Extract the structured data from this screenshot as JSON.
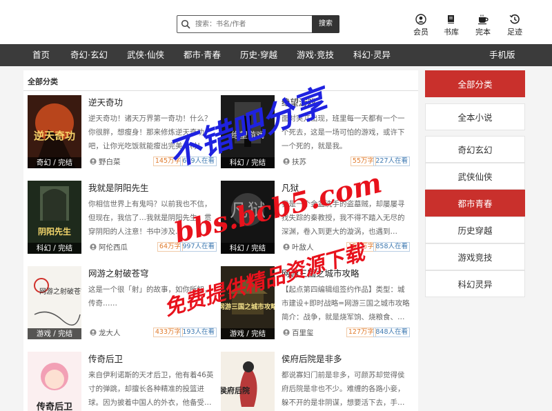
{
  "header": {
    "search_placeholder": "搜索：书名/作者",
    "search_button": "搜索",
    "tools": [
      {
        "label": "会员",
        "icon": "user-icon"
      },
      {
        "label": "书库",
        "icon": "book-icon"
      },
      {
        "label": "完本",
        "icon": "cup-icon"
      },
      {
        "label": "足迹",
        "icon": "history-icon"
      }
    ]
  },
  "nav": {
    "items": [
      "首页",
      "奇幻·玄幻",
      "武侠·仙侠",
      "都市·青春",
      "历史·穿越",
      "游戏·竞技",
      "科幻·灵异"
    ],
    "mobile": "手机版"
  },
  "main": {
    "title": "全部分类",
    "books": [
      {
        "title": "逆天奇功",
        "desc": "逆天奇功！诸天万界第一奇功！什么？你很胖，想瘦身！那来修炼逆天奇功吧，让你光吃饭就能瘦出完美身材！",
        "author": "野白菜",
        "words": "145万字",
        "reads": "659人在看",
        "tag": "奇幻 / 完结",
        "cover_text": "逆天奇功"
      },
      {
        "title": "绝望游戏",
        "desc": "面对突兀出现，班里每一天都有一个一个死去，这是一场可怕的游戏，或许下一个死的，就是我。",
        "author": "扶苏",
        "words": "55万字",
        "reads": "227人在看",
        "tag": "科幻 / 完结",
        "cover_text": "绝望游戏"
      },
      {
        "title": "我就是阴阳先生",
        "desc": "你相信世界上有鬼吗？以前我也不信，但现在，我信了…我就是阴阳先生，贯穿阴阳的人注意！书中涉及…",
        "author": "阿伦西瓜",
        "words": "64万字",
        "reads": "997人在看",
        "tag": "科幻 / 完结",
        "cover_text": "阴阳先生"
      },
      {
        "title": "凡狱",
        "desc": "我是一个金盆洗手的盗墓贼，却屡屡寻找失踪的秦教授，我不得不踏入无尽的深渊，卷入到更大的漩涡，也遇到…",
        "author": "叶敌人",
        "words": "157万字",
        "reads": "858人在看",
        "tag": "科幻 / 完结",
        "cover_text": "凡狱"
      },
      {
        "title": "网游之射破苍穹",
        "desc": "这是一个很「射」的故事，如你所知，传奇……",
        "author": "龙大人",
        "words": "433万字",
        "reads": "193人在看",
        "tag": "游戏 / 完结",
        "cover_text": "网游之射破苍穹"
      },
      {
        "title": "网游三国之城市攻略",
        "desc": "【起点第四编辑组签约作品】类型：城市建设+即时战略=网游三国之城市攻略简介：战争，就是烧军饷、烧粮食、…",
        "author": "百里玺",
        "words": "127万字",
        "reads": "848人在看",
        "tag": "游戏 / 完结",
        "cover_text": "网游三国之城市攻略"
      },
      {
        "title": "传奇后卫",
        "desc": "来自伊利诺斯的天才后卫，他有着46英寸的弹跳，却擅长各种精准的投篮进球。因为披着中国人的外衣，他备受…",
        "author": "",
        "words": "",
        "reads": "",
        "tag": "",
        "cover_text": "传奇后卫"
      },
      {
        "title": "侯府后院是非多",
        "desc": "都说寡妇门前是非多，可颜苏却觉得侯府后院是非也不少。难缠的各路小妾，躲不开的是非阴谋，想要活下去，手…",
        "author": "",
        "words": "",
        "reads": "",
        "tag": "",
        "cover_text": "侯府后院"
      }
    ]
  },
  "sidebar": {
    "items": [
      {
        "label": "全部分类",
        "active": true
      },
      {
        "label": "全本小说",
        "active": false
      },
      {
        "label": "奇幻玄幻",
        "active": false
      },
      {
        "label": "武侠仙侠",
        "active": false
      },
      {
        "label": "都市青春",
        "active": true
      },
      {
        "label": "历史穿越",
        "active": false
      },
      {
        "label": "游戏竞技",
        "active": false
      },
      {
        "label": "科幻灵异",
        "active": false
      }
    ]
  },
  "watermark": {
    "line1": "不错吧分享",
    "line2": "bbs.bcb5.com",
    "line3": "免费提供精品资源下载"
  },
  "colors": {
    "accent": "#c9302c",
    "nav_bg": "#3b3b3b",
    "watermark_blue": "#1f22e0",
    "watermark_red": "#e8121c"
  }
}
